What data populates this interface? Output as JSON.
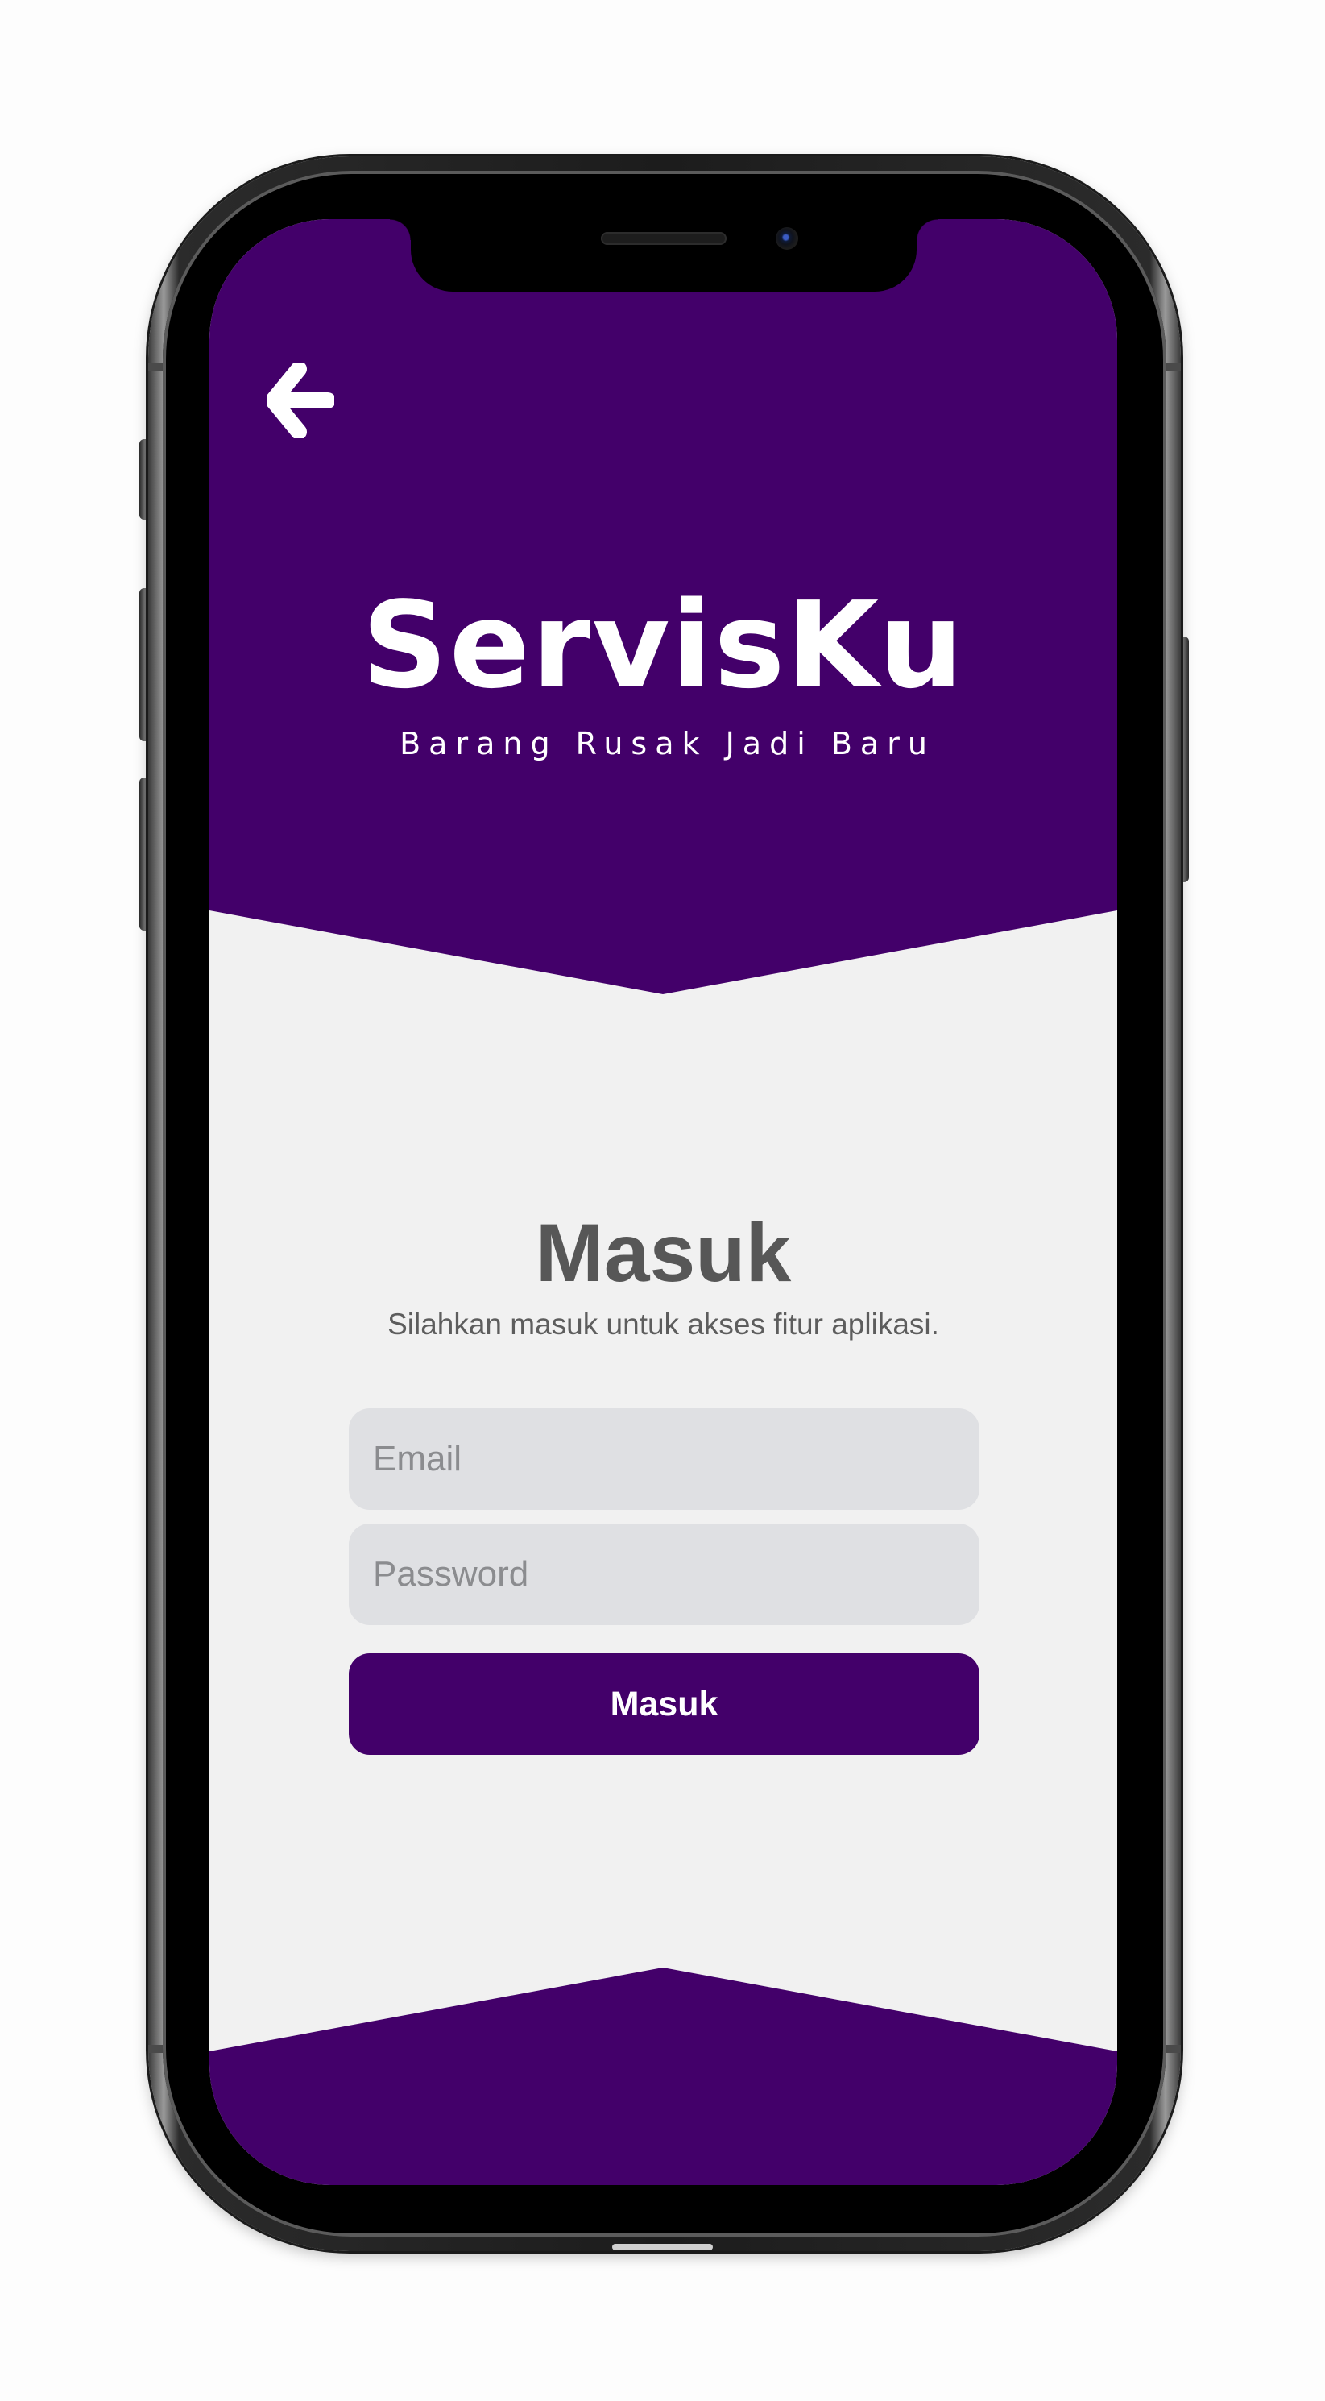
{
  "app": {
    "name": "ServisKu",
    "tagline": "Barang Rusak Jadi Baru"
  },
  "header": {
    "back_icon": "arrow-left-icon"
  },
  "login": {
    "title": "Masuk",
    "subtitle": "Silahkan masuk untuk akses fitur aplikasi.",
    "email_placeholder": "Email",
    "email_value": "",
    "password_placeholder": "Password",
    "password_value": "",
    "submit_label": "Masuk"
  },
  "colors": {
    "brand_purple": "#43006a",
    "screen_background": "#f1f1f1",
    "input_background": "#dfe0e3",
    "heading_text": "#575757"
  }
}
